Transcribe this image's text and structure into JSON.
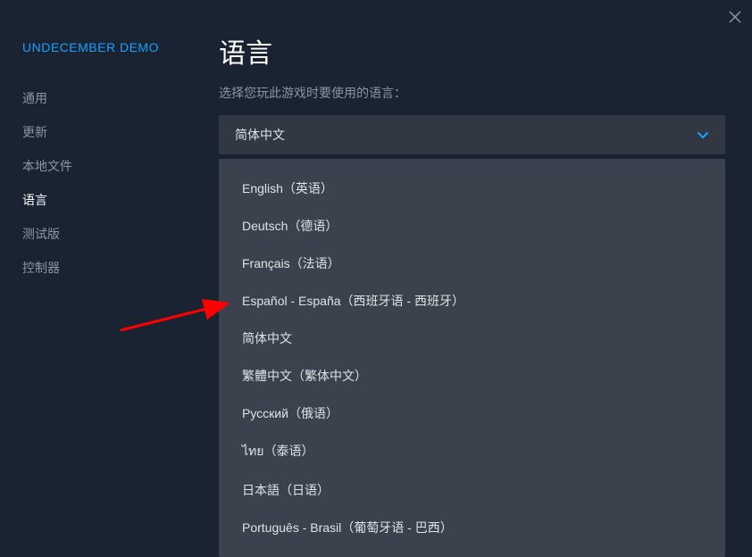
{
  "header": {
    "gameTitle": "UNDECEMBER DEMO"
  },
  "sidebar": {
    "items": [
      {
        "label": "通用",
        "active": false
      },
      {
        "label": "更新",
        "active": false
      },
      {
        "label": "本地文件",
        "active": false
      },
      {
        "label": "语言",
        "active": true
      },
      {
        "label": "测试版",
        "active": false
      },
      {
        "label": "控制器",
        "active": false
      }
    ]
  },
  "main": {
    "title": "语言",
    "subtitle": "选择您玩此游戏时要使用的语言：",
    "selected": "简体中文",
    "options": [
      "English（英语）",
      "Deutsch（德语）",
      "Français（法语）",
      "Español - España（西班牙语 - 西班牙）",
      "简体中文",
      "繁體中文（繁体中文）",
      "Русский（俄语）",
      "ไทย（泰语）",
      "日本語（日语）",
      "Português - Brasil（葡萄牙语 - 巴西）"
    ]
  }
}
